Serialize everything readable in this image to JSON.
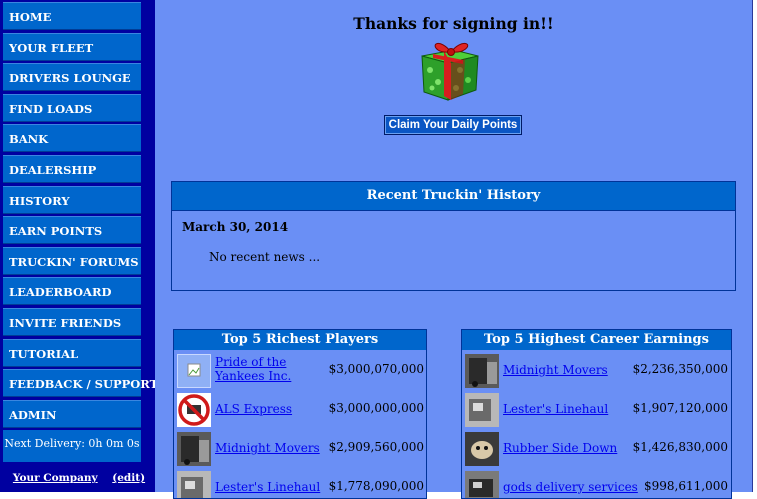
{
  "sidebar": {
    "items": [
      {
        "label": "HOME"
      },
      {
        "label": "YOUR FLEET"
      },
      {
        "label": "DRIVERS LOUNGE"
      },
      {
        "label": "FIND LOADS"
      },
      {
        "label": "BANK"
      },
      {
        "label": "DEALERSHIP"
      },
      {
        "label": "HISTORY"
      },
      {
        "label": "EARN POINTS"
      },
      {
        "label": "TRUCKIN' FORUMS"
      },
      {
        "label": "LEADERBOARD"
      },
      {
        "label": "INVITE FRIENDS"
      },
      {
        "label": "TUTORIAL"
      },
      {
        "label": "FEEDBACK / SUPPORT"
      },
      {
        "label": "ADMIN"
      }
    ],
    "next_delivery": "Next Delivery: 0h 0m 0s",
    "company_link": "Your Company",
    "edit_link": "(edit)"
  },
  "welcome": {
    "title": "Thanks for signing in!!",
    "gift_icon": "gift-box-icon",
    "claim_button": "Claim Your Daily Points"
  },
  "history": {
    "title": "Recent Truckin' History",
    "date": "March 30, 2014",
    "news": "No recent news ..."
  },
  "richest": {
    "title": "Top 5 Richest Players",
    "rows": [
      {
        "name": "Pride of the Yankees Inc.",
        "value": "$3,000,070,000",
        "icon": "broken-image-icon"
      },
      {
        "name": "ALS Express",
        "value": "$3,000,000,000",
        "icon": "no-sign-icon"
      },
      {
        "name": "Midnight Movers",
        "value": "$2,909,560,000",
        "icon": "truck-photo"
      },
      {
        "name": "Lester's Linehaul",
        "value": "$1,778,090,000",
        "icon": "truck-photo"
      }
    ]
  },
  "earnings": {
    "title": "Top 5 Highest Career Earnings",
    "rows": [
      {
        "name": "Midnight Movers",
        "value": "$2,236,350,000",
        "icon": "truck-photo"
      },
      {
        "name": "Lester's Linehaul",
        "value": "$1,907,120,000",
        "icon": "truck-photo"
      },
      {
        "name": "Rubber Side Down",
        "value": "$1,426,830,000",
        "icon": "animal-photo"
      },
      {
        "name": "gods delivery services",
        "value": "$998,611,000",
        "icon": "truck-photo"
      }
    ]
  },
  "colors": {
    "sidebar_bg": "#0000a0",
    "nav_item": "#0066cc",
    "main_bg": "#6a8ff5",
    "link": "#0000ee"
  }
}
